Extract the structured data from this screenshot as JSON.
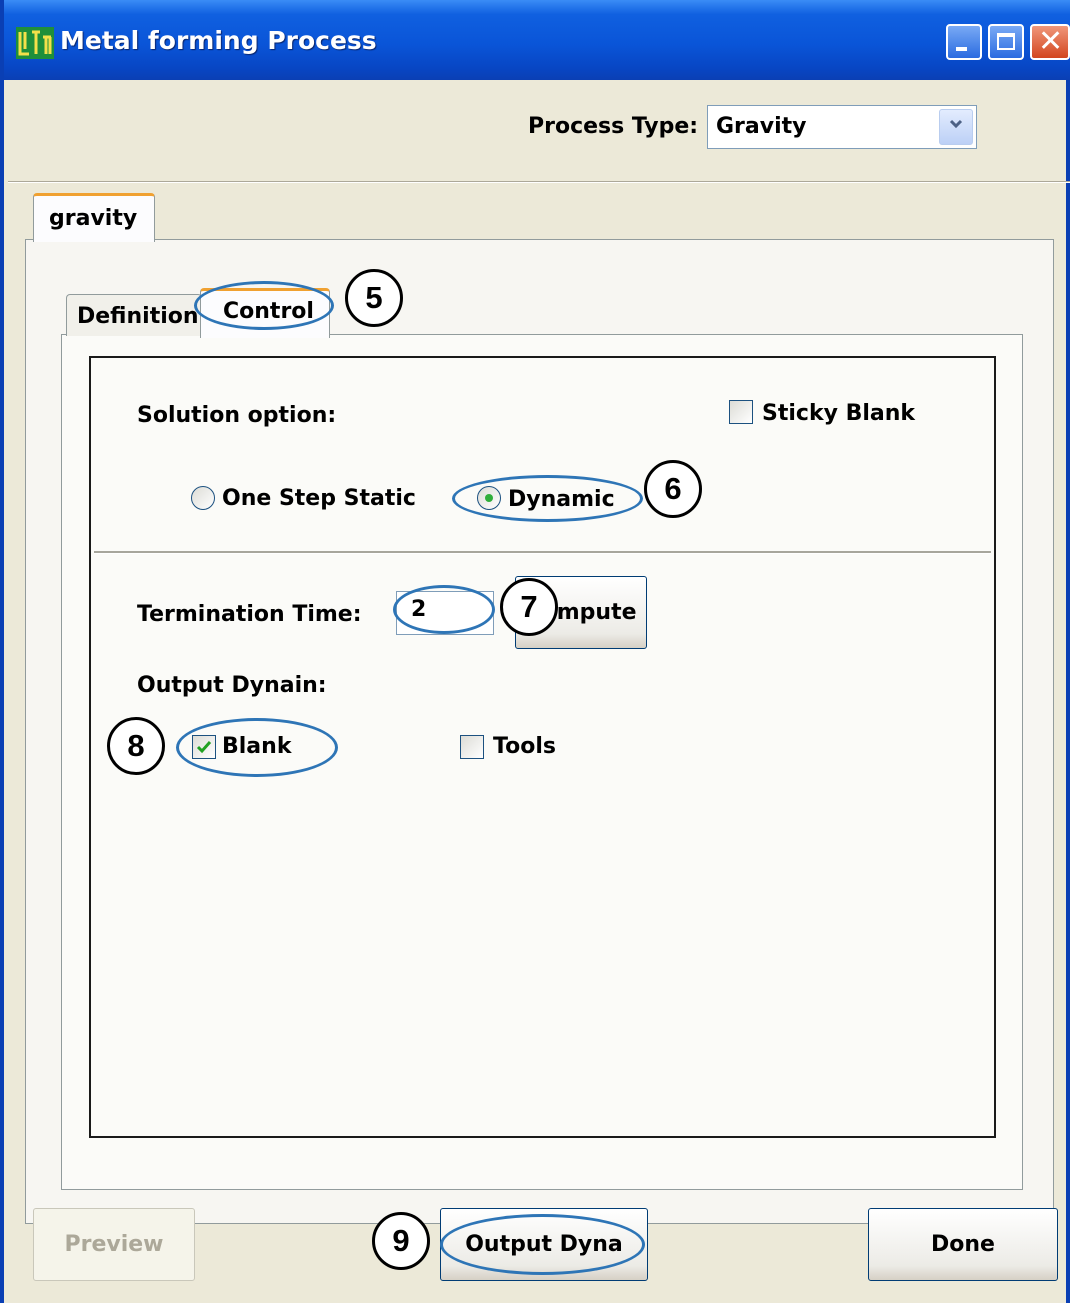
{
  "window": {
    "title": "Metal forming Process",
    "icon": "ls-logo-icon",
    "controls": [
      "minimize-icon",
      "maximize-icon",
      "close-icon"
    ]
  },
  "process_type": {
    "label": "Process Type:",
    "value": "Gravity"
  },
  "outer_tab": {
    "label": "gravity",
    "selected": true
  },
  "inner_tabs": [
    {
      "label": "Definition",
      "selected": false
    },
    {
      "label": "Control",
      "selected": true
    }
  ],
  "solution": {
    "label": "Solution option:",
    "sticky_blank": {
      "label": "Sticky Blank",
      "checked": false
    },
    "options": [
      {
        "label": "One Step Static",
        "selected": false
      },
      {
        "label": "Dynamic",
        "selected": true
      }
    ]
  },
  "termination": {
    "label": "Termination Time:",
    "value": "2",
    "button_label": "Compute"
  },
  "output_dynain": {
    "label": "Output Dynain:",
    "blank": {
      "label": "Blank",
      "checked": true
    },
    "tools": {
      "label": "Tools",
      "checked": false
    }
  },
  "buttons": {
    "preview": {
      "label": "Preview",
      "enabled": false
    },
    "output_dyna": {
      "label": "Output Dyna",
      "enabled": true
    },
    "done": {
      "label": "Done",
      "enabled": true
    }
  },
  "callouts": [
    "5",
    "6",
    "7",
    "8",
    "9"
  ],
  "colors": {
    "titlebar": "#0a55d8",
    "dialog_bg": "#ece9d8",
    "tab_highlight": "#f0a131",
    "annotation_ellipse": "#2e75b6",
    "checkmark": "#21a121"
  }
}
